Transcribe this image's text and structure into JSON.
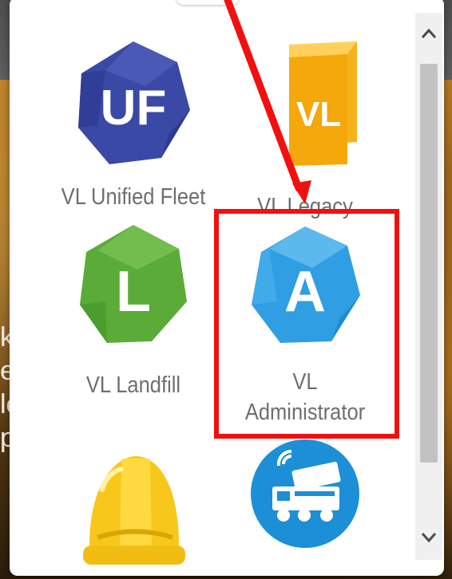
{
  "background": {
    "text_lines": [
      "k",
      "e",
      "le",
      "p"
    ]
  },
  "popup": {
    "apps": [
      {
        "name": "VL Unified Fleet",
        "icon": "unified-fleet-icon",
        "icon_text": "UF",
        "color": "#3a4aa8"
      },
      {
        "name": "VL Legacy",
        "icon": "legacy-icon",
        "icon_text": "VL",
        "color": "#f4ac0a"
      },
      {
        "name": "VL Landfill",
        "icon": "landfill-icon",
        "icon_text": "L",
        "color": "#5faf3a"
      },
      {
        "name_line1": "VL",
        "name_line2": "Administrator",
        "icon": "administrator-icon",
        "icon_text": "A",
        "color": "#2e9fe3"
      },
      {
        "name": "",
        "icon": "hard-hat-icon",
        "color": "#f7c81b"
      },
      {
        "name": "",
        "icon": "truck-tracking-icon",
        "color": "#1c8fd7"
      }
    ],
    "scrollbar": {
      "up_icon": "chevron-up-icon",
      "down_icon": "chevron-down-icon"
    }
  },
  "annotation": {
    "arrow_color": "#f20f0f",
    "box_color": "#f20f0f",
    "highlighted_app": "VL Administrator"
  }
}
